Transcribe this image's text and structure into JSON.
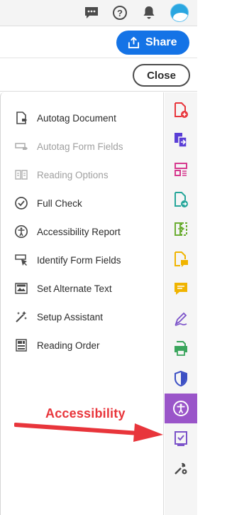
{
  "header": {
    "icons": [
      "chat-icon",
      "help-icon",
      "bell-icon",
      "avatar"
    ],
    "help_glyph": "?"
  },
  "share": {
    "label": "Share"
  },
  "close": {
    "label": "Close"
  },
  "tools": [
    {
      "label": "Autotag Document",
      "icon": "autotag-document-icon",
      "enabled": true
    },
    {
      "label": "Autotag Form Fields",
      "icon": "autotag-form-fields-icon",
      "enabled": false
    },
    {
      "label": "Reading Options",
      "icon": "reading-options-icon",
      "enabled": false
    },
    {
      "label": "Full Check",
      "icon": "full-check-icon",
      "enabled": true
    },
    {
      "label": "Accessibility Report",
      "icon": "accessibility-report-icon",
      "enabled": true
    },
    {
      "label": "Identify Form Fields",
      "icon": "identify-form-fields-icon",
      "enabled": true
    },
    {
      "label": "Set Alternate Text",
      "icon": "set-alternate-text-icon",
      "enabled": true
    },
    {
      "label": "Setup Assistant",
      "icon": "setup-assistant-icon",
      "enabled": true
    },
    {
      "label": "Reading Order",
      "icon": "reading-order-icon",
      "enabled": true
    }
  ],
  "rail": [
    {
      "icon": "create-pdf-icon",
      "color": "#e8353b"
    },
    {
      "icon": "combine-files-icon",
      "color": "#5a3ed6"
    },
    {
      "icon": "organize-pages-icon",
      "color": "#d63a8f"
    },
    {
      "icon": "export-pdf-icon",
      "color": "#26a69a"
    },
    {
      "icon": "compare-files-icon",
      "color": "#6cae34"
    },
    {
      "icon": "comment-file-icon",
      "color": "#f0b400"
    },
    {
      "icon": "comment-icon",
      "color": "#f0b400"
    },
    {
      "icon": "fill-sign-icon",
      "color": "#7b52c9"
    },
    {
      "icon": "print-production-icon",
      "color": "#3aa55c"
    },
    {
      "icon": "protect-icon",
      "color": "#3b4fc4"
    },
    {
      "icon": "accessibility-icon",
      "color": "#ffffff",
      "active": true
    },
    {
      "icon": "action-wizard-icon",
      "color": "#7b52c9"
    },
    {
      "icon": "more-tools-icon",
      "color": "#4b4b4b"
    }
  ],
  "annotation": {
    "label": "Accessibility",
    "color": "#e8353b"
  },
  "colors": {
    "accent": "#1473e6",
    "active_rail": "#9a55c9"
  }
}
